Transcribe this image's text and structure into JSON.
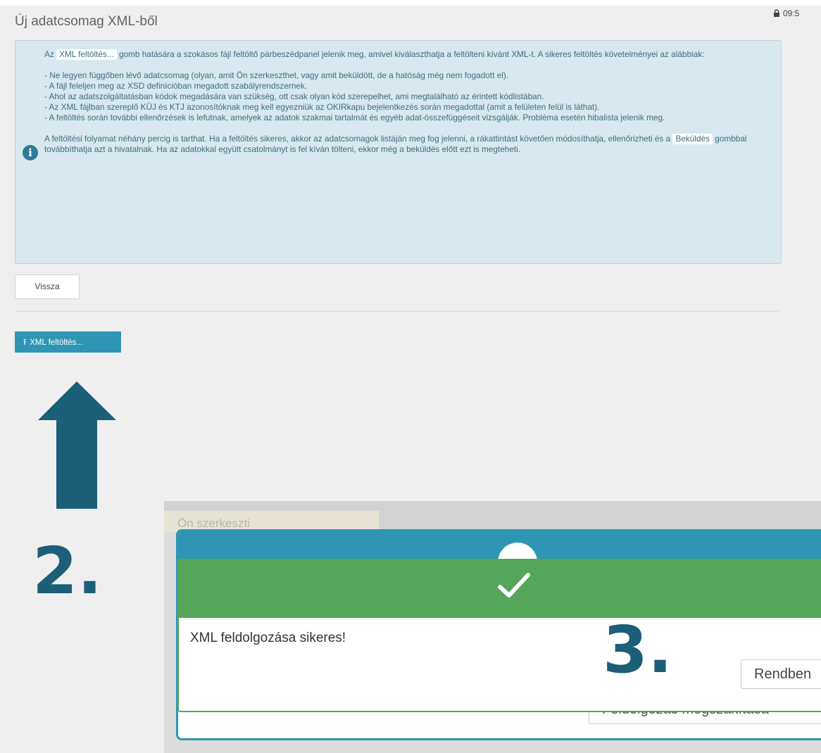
{
  "page": {
    "title": "Új adatcsomag XML-ből",
    "lock_time": "09:5"
  },
  "info": {
    "p1_prefix": "Az",
    "p1_tag": "XML feltöltés...",
    "p1_suffix": "gomb hatására a szokásos fájl feltöltő párbeszédpanel jelenik meg, amivel kiválaszthatja a feltölteni kívánt XML-t. A sikeres feltöltés követelményei az alábbiak:",
    "bullet1": "- Ne legyen függőben lévő adatcsomag (olyan, amit Ön szerkeszthet, vagy amit beküldött, de a hatóság még nem fogadott el).",
    "bullet2": "- A fájl feleljen meg az XSD definícióban megadott szabályrendszernek.",
    "bullet3": "- Ahol az adatszolgáltatásban kódok megadására van szükség, ott csak olyan kód szerepelhet, ami megtalálható az érintett kódlistában.",
    "bullet4": "- Az XML fájlban szereplő KÜJ és KTJ azonosítóknak meg kell egyezniük az OKIRkapu bejelentkezés során megadottal (amit a felületen felül is láthat).",
    "bullet5": "- A feltöltés során további ellenőrzések is lefutnak, amelyek az adatok szakmai tartalmát és egyéb adat-összefüggéseit vizsgálják. Probléma esetén hibalista jelenik meg.",
    "p3_prefix": "A feltöltési folyamat néhány percig is tarthat. Ha a feltöltés sikeres, akkor az adatcsomagok listáján meg fog jelenni, a rákattintást követően módosíthatja, ellenőrizheti és a",
    "p3_tag": "Beküldés",
    "p3_suffix": "gombbal továbbíthatja azt a hivatalnak. Ha az adatokkal együtt csatolmányt is fel kíván tölteni, ekkor még a beküldés előtt ezt is megteheti."
  },
  "buttons": {
    "back": "Vissza",
    "upload": "XML feltöltés..."
  },
  "steps": {
    "step2": "2.",
    "step3": "3."
  },
  "dialog": {
    "bg_text": "Ön szerkeszti",
    "hidden_button": "Feldolgozás megszakítása",
    "success_message": "XML feldolgozása sikeres!",
    "ok_button": "Rendben"
  },
  "colors": {
    "accent": "#2e96b4",
    "success": "#55a55a",
    "arrow": "#1b5f78",
    "info_bg": "#d8e8ee"
  }
}
